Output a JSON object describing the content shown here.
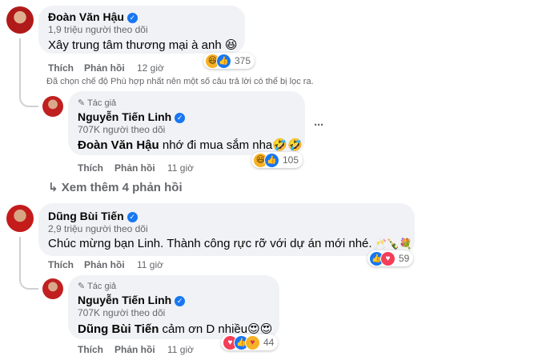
{
  "comments": [
    {
      "author": "Đoàn Văn Hậu",
      "followers": "1,9 triệu người theo dõi",
      "text": "Xây trung tâm thương mại à anh 😆",
      "like_label": "Thích",
      "reply_label": "Phản hồi",
      "time": "12 giờ",
      "reaction_count": "375"
    },
    {
      "author": "Dũng Bùi Tiến",
      "followers": "2,9 triệu người theo dõi",
      "text": "Chúc mừng bạn Linh. Thành công rực rỡ với dự án mới nhé.",
      "text_emoji": "🥂🍾💐",
      "like_label": "Thích",
      "reply_label": "Phản hồi",
      "time": "11 giờ",
      "reaction_count": "59"
    }
  ],
  "filter_notice": "Đã chọn chế độ Phù hợp nhất nên một số câu trả lời có thể bị lọc ra.",
  "replies": [
    {
      "author_tag": "Tác giả",
      "author": "Nguyễn Tiến Linh",
      "followers": "707K người theo dõi",
      "mention": "Đoàn Văn Hậu",
      "text": " nhớ đi mua sắm nha🤣🤣",
      "like_label": "Thích",
      "reply_label": "Phản hồi",
      "time": "11 giờ",
      "reaction_count": "105"
    },
    {
      "author_tag": "Tác giả",
      "author": "Nguyễn Tiến Linh",
      "followers": "707K người theo dõi",
      "mention": "Dũng Bùi Tiến",
      "text": " cảm ơn D nhiều😍😍",
      "like_label": "Thích",
      "reply_label": "Phản hồi",
      "time": "11 giờ",
      "reaction_count": "44"
    }
  ],
  "more_replies": "Xem thêm 4 phản hồi",
  "more_options": "···",
  "colors": {
    "bubble": "#f0f2f5",
    "secondary_text": "#65676b",
    "verified": "#1877f2",
    "love": "#f33e58"
  },
  "icons": [
    "verified-badge-icon",
    "pencil-icon",
    "reply-arrow-icon",
    "more-options-icon",
    "haha-reaction-icon",
    "like-reaction-icon",
    "love-reaction-icon",
    "care-reaction-icon"
  ]
}
